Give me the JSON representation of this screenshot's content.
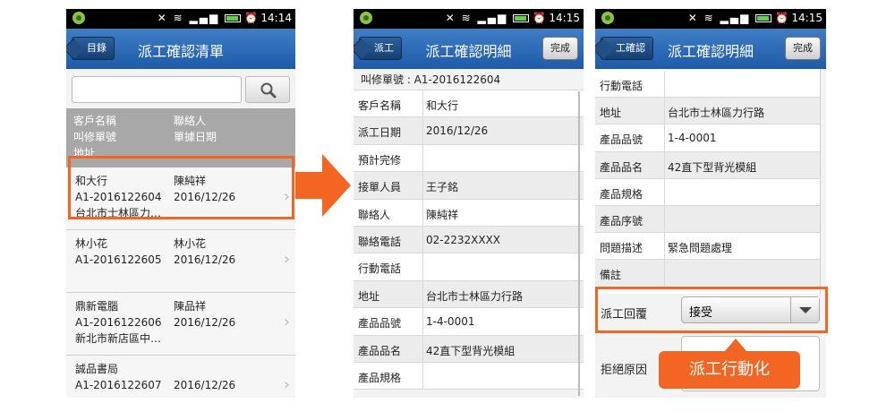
{
  "status": {
    "time1": "14:14",
    "time2": "14:15",
    "time3": "14:15"
  },
  "list_screen": {
    "title": "派工確認清單",
    "back_label": "目錄",
    "search": {
      "placeholder": ""
    },
    "header": {
      "col1": [
        "客戶名稱",
        "叫修單號",
        "地址"
      ],
      "col2": [
        "聯絡人",
        "單據日期"
      ]
    },
    "items": [
      {
        "customer": "和大行",
        "order": "A1-2016122604",
        "address": "台北市士林區力…",
        "contact": "陳純祥",
        "date": "2016/12/26"
      },
      {
        "customer": "林小花",
        "order": "A1-2016122605",
        "address": "",
        "contact": "林小花",
        "date": "2016/12/26"
      },
      {
        "customer": "鼎新電腦",
        "order": "A1-2016122606",
        "address": "新北市新店區中…",
        "contact": "陳品祥",
        "date": "2016/12/26"
      },
      {
        "customer": "誠品書局",
        "order": "A1-2016122607",
        "address": "",
        "contact": "",
        "date": "2016/12/26"
      }
    ]
  },
  "detail_screen": {
    "title": "派工確認明細",
    "back_label": "派工",
    "done_label": "完成",
    "request_no": "叫修單號 : A1-2016122604",
    "rows": [
      {
        "label": "客戶名稱",
        "value": "和大行"
      },
      {
        "label": "派工日期",
        "value": "2016/12/26"
      },
      {
        "label": "預計完修",
        "value": ""
      },
      {
        "label": "接單人員",
        "value": "王子銘"
      },
      {
        "label": "聯絡人",
        "value": "陳純祥"
      },
      {
        "label": "聯絡電話",
        "value": "02-2232XXXX"
      },
      {
        "label": "行動電話",
        "value": ""
      },
      {
        "label": "地址",
        "value": "台北市士林區力行路"
      },
      {
        "label": "產品品號",
        "value": "1-4-0001"
      },
      {
        "label": "產品品名",
        "value": "42直下型背光模組"
      },
      {
        "label": "產品規格",
        "value": ""
      }
    ]
  },
  "detail_screen2": {
    "title": "派工確認明細",
    "back_label": "工確認",
    "done_label": "完成",
    "rows": [
      {
        "label": "行動電話",
        "value": ""
      },
      {
        "label": "地址",
        "value": "台北市士林區力行路"
      },
      {
        "label": "產品品號",
        "value": "1-4-0001"
      },
      {
        "label": "產品品名",
        "value": "42直下型背光模組"
      },
      {
        "label": "產品規格",
        "value": ""
      },
      {
        "label": "產品序號",
        "value": ""
      },
      {
        "label": "問題描述",
        "value": "緊急問題處理"
      },
      {
        "label": "備註",
        "value": ""
      }
    ],
    "reply_label": "派工回覆",
    "reply_value": "接受",
    "reject_label": "拒絕原因"
  },
  "callout": "派工行動化",
  "colors": {
    "accent": "#f26522",
    "titlebar": "#2a66b2",
    "header_gray": "#a8a8a8"
  }
}
